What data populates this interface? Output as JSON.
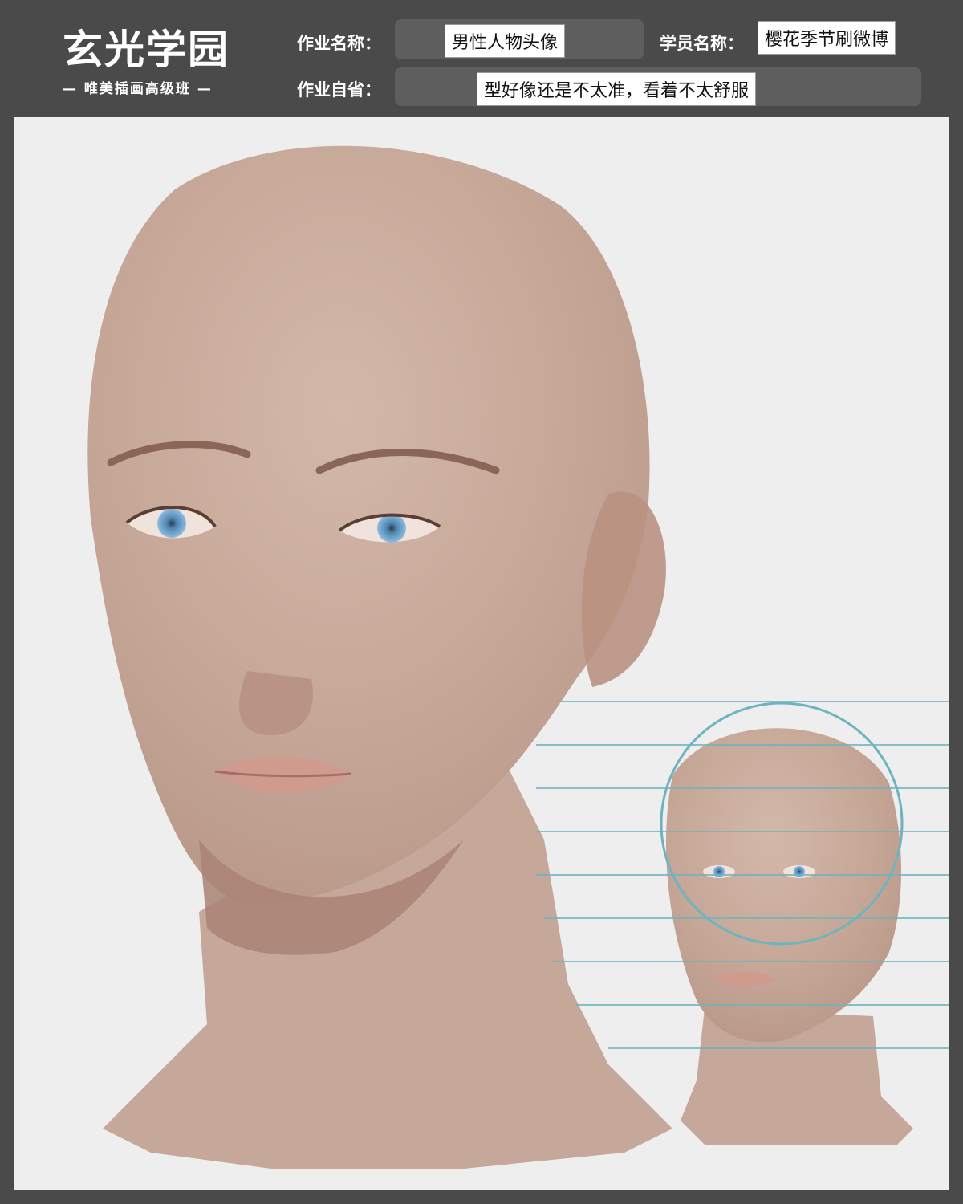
{
  "brand": {
    "title": "玄光学园",
    "subtitle": "— 唯美插画高级班 —"
  },
  "form": {
    "assignment_name_label": "作业名称：",
    "assignment_name_value": "男性人物头像",
    "student_name_label": "学员名称：",
    "student_name_value": "樱花季节刷微博",
    "self_review_label": "作业自省：",
    "self_review_value": "型好像还是不太准，看着不太舒服"
  },
  "colors": {
    "background": "#4a4a4a",
    "field_box": "#5e5e5e",
    "canvas": "#eeeeee",
    "skin": "#c9ab9b",
    "skin_shadow": "#a98576",
    "guide_line": "#6fb3bf",
    "iris": "#6a9cc4"
  },
  "artwork": {
    "main_portrait": "painted-male-head-front-view",
    "reference_thumbnail": "male-head-with-proportion-guides"
  }
}
